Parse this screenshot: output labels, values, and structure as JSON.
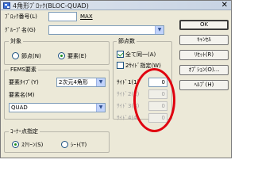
{
  "window": {
    "title": "4角形ﾌﾞﾛｯｸ(BLOC-QUAD)",
    "close_glyph": "✕"
  },
  "block_number": {
    "label": "ﾌﾞﾛｯｸ番号(L)",
    "value": "",
    "max_label": "MAX"
  },
  "group_name": {
    "label": "ｸﾞﾙｰﾌﾟ名(G)",
    "value": ""
  },
  "target": {
    "legend": "対象",
    "options": [
      {
        "label": "節点(N)",
        "selected": false
      },
      {
        "label": "要素(E)",
        "selected": true
      }
    ]
  },
  "fems_element": {
    "legend": "FEMS要素",
    "type_label": "要素ﾀｲﾌﾟ(Y)",
    "type_value": "2次元4角形",
    "name_label": "要素名(M)",
    "name_value": "QUAD"
  },
  "corner_point": {
    "legend": "ｺｰﾅｰ点指定",
    "options": [
      {
        "label": "ｽｸﾘｰﾝ(S)",
        "selected": true
      },
      {
        "label": "ｼｰﾄ(T)",
        "selected": false
      }
    ]
  },
  "node_count": {
    "legend": "節点数",
    "all_same": {
      "label": "全て同一(A)",
      "checked": true
    },
    "two_side": {
      "label": "2ｻｲﾄﾞ指定(W)",
      "checked": false
    },
    "sides": [
      {
        "label": "ｻｲﾄﾞ1(1)",
        "value": "0",
        "enabled": true
      },
      {
        "label": "ｻｲﾄﾞ2(2)",
        "value": "0",
        "enabled": false
      },
      {
        "label": "ｻｲﾄﾞ3(3)",
        "value": "0",
        "enabled": false
      },
      {
        "label": "ｻｲﾄﾞ4(4)",
        "value": "0",
        "enabled": false
      }
    ]
  },
  "buttons": {
    "ok": "OK",
    "cancel": "ｷｬﾝｾﾙ",
    "reset": "ﾘｾｯﾄ(R)",
    "options": "ｵﾌﾟｼｮﾝ(O)...",
    "help": "ﾍﾙﾌﾟ(H)"
  },
  "colors": {
    "annotation": "#e0000f"
  }
}
